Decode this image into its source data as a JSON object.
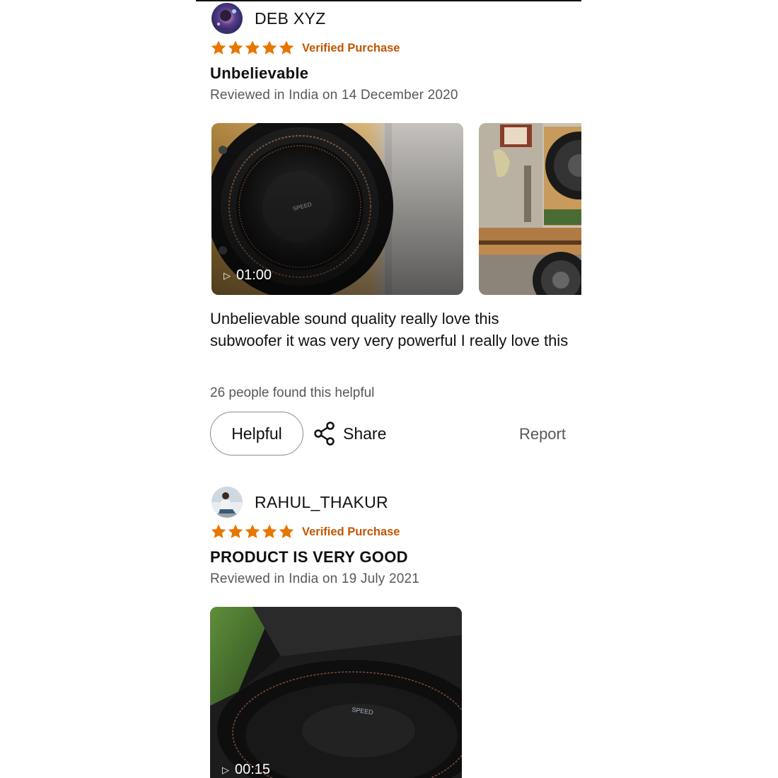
{
  "reviews": [
    {
      "reviewer": "DEB XYZ",
      "rating": 5,
      "verified": "Verified Purchase",
      "title": "Unbelievable",
      "date": "Reviewed in India on 14 December 2020",
      "video_duration": "01:00",
      "body": "Unbelievable sound quality really love this subwoofer it was very very powerful I really love this",
      "helpful_count": "26 people found this helpful",
      "helpful_label": "Helpful",
      "share_label": "Share",
      "report_label": "Report"
    },
    {
      "reviewer": "RAHUL_THAKUR",
      "rating": 5,
      "verified": "Verified Purchase",
      "title": "PRODUCT IS VERY GOOD",
      "date": "Reviewed in India on 19 July 2021",
      "video_duration": "00:15"
    }
  ],
  "colors": {
    "star": "#e77600",
    "verified": "#c45500",
    "secondary_text": "#565959"
  },
  "icons": [
    "play-icon",
    "share-icon",
    "star-icon"
  ]
}
